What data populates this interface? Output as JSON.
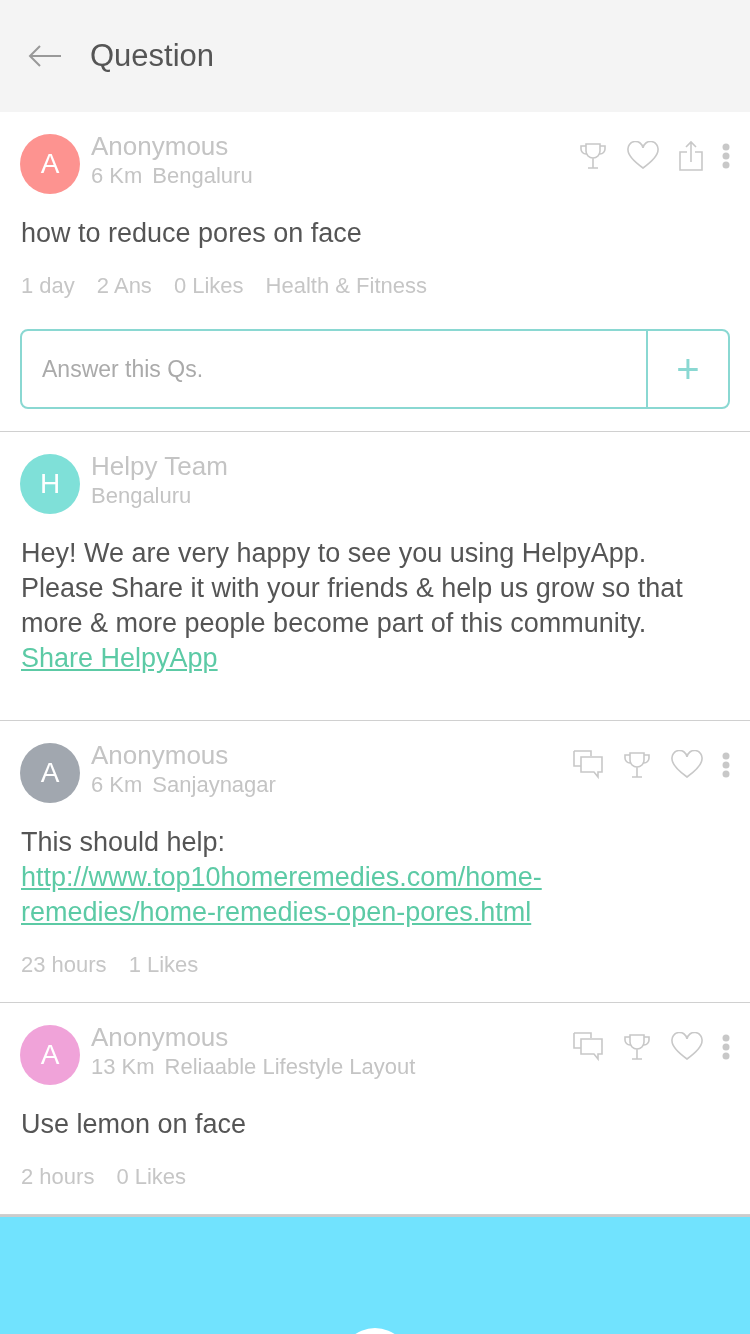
{
  "header": {
    "title": "Question"
  },
  "question": {
    "avatar": {
      "letter": "A",
      "color": "#fd9390"
    },
    "author": "Anonymous",
    "distance": "6 Km",
    "location": "Bengaluru",
    "text": "how to reduce pores on face",
    "meta": [
      "1 day",
      "2 Ans",
      "0 Likes",
      "Health & Fitness"
    ],
    "answer_field": {
      "placeholder": "Answer this Qs.",
      "button": "+"
    }
  },
  "answers": [
    {
      "kind": "notice",
      "avatar": {
        "letter": "H",
        "color": "#7fe0d8"
      },
      "author": "Helpy Team",
      "location": "Bengaluru",
      "body": [
        {
          "text": "Hey! We are very happy to see you using HelpyApp. Please Share it with your friends & help us grow so that more & more people become part of this community. ",
          "link": false
        },
        {
          "text": "Share HelpyApp",
          "link": true
        }
      ]
    },
    {
      "kind": "answer",
      "avatar": {
        "letter": "A",
        "color": "#a1a7af"
      },
      "author": "Anonymous",
      "distance": "6 Km",
      "location": "Sanjaynagar",
      "body": [
        {
          "text": "This should help: ",
          "link": false
        },
        {
          "text": "http://www.top10homeremedies.com/home-remedies/home-remedies-open-pores.html",
          "link": true
        }
      ],
      "meta": [
        "23 hours",
        "1 Likes"
      ]
    },
    {
      "kind": "answer",
      "avatar": {
        "letter": "A",
        "color": "#f0a3d9"
      },
      "author": "Anonymous",
      "distance": "13 Km",
      "location": "Reliaable Lifestyle Layout",
      "body": [
        {
          "text": "Use lemon on face",
          "link": false
        }
      ],
      "meta": [
        "2 hours",
        "0 Likes"
      ]
    }
  ]
}
